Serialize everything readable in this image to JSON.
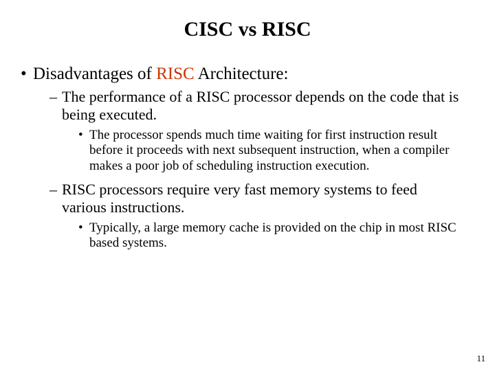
{
  "title": "CISC vs RISC",
  "lvl1_prefix": "Disadvantages of ",
  "lvl1_highlight": "RISC",
  "lvl1_suffix": " Architecture:",
  "lvl2a": "The performance of  a RISC processor depends on the code that is being executed.",
  "lvl3a": "The processor spends much time waiting for first instruction result before it proceeds with next subsequent instruction, when a compiler makes a poor job of scheduling instruction execution.",
  "lvl2b": "RISC processors require very fast memory systems to feed various instructions.",
  "lvl3b": "Typically, a large memory cache is provided on the chip in most RISC based systems.",
  "page_number": "11"
}
